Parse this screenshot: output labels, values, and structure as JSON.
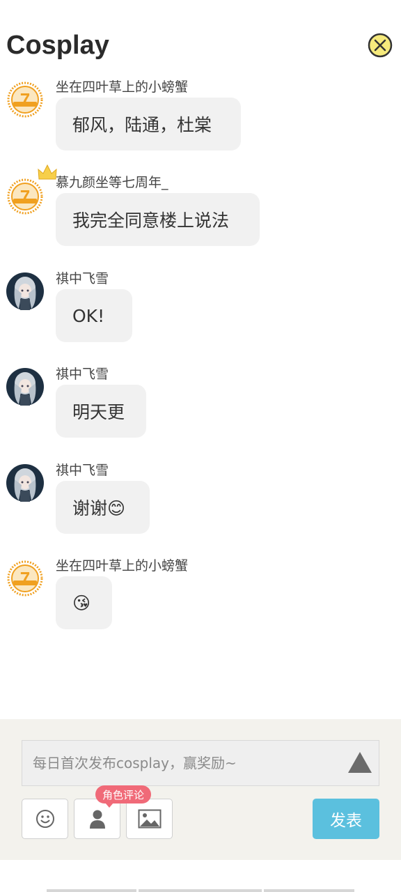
{
  "header": {
    "title": "Cosplay"
  },
  "messages": [
    {
      "user": "坐在四叶草上的小螃蟹",
      "text": "郁风，陆通，杜棠",
      "avatar": "tfboys-7-badge"
    },
    {
      "user": "慕九颜坐等七周年_",
      "text": "我完全同意楼上说法",
      "avatar": "tfboys-7-badge-crown"
    },
    {
      "user": "祺中飞雪",
      "text": "OK!",
      "avatar": "anime-girl"
    },
    {
      "user": "祺中飞雪",
      "text": "明天更",
      "avatar": "anime-girl"
    },
    {
      "user": "祺中飞雪",
      "text": "谢谢😊",
      "avatar": "anime-girl"
    },
    {
      "user": "坐在四叶草上的小螃蟹",
      "text": "😘",
      "avatar": "tfboys-7-badge"
    }
  ],
  "composer": {
    "placeholder": "每日首次发布cosplay，赢奖励~",
    "role_tag": "角色评论",
    "post_label": "发表"
  },
  "colors": {
    "accent": "#5bc0de",
    "tag": "#f06a78",
    "close_icon": "#f5e87a",
    "badge": "#f0a020"
  }
}
